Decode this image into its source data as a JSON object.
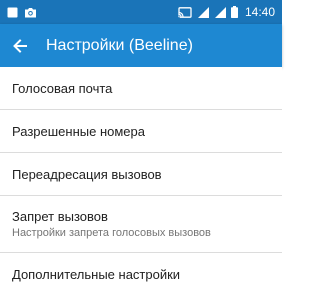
{
  "status_bar": {
    "time": "14:40",
    "left_icons": [
      "notification-square-icon",
      "camera-icon"
    ],
    "right_icons": [
      "cast-icon",
      "wifi-signal-icon",
      "cell-signal-icon",
      "battery-icon"
    ]
  },
  "toolbar": {
    "title": "Настройки (Beeline)",
    "back_icon": "arrow-left-icon"
  },
  "menu": {
    "items": [
      {
        "title": "Голосовая почта"
      },
      {
        "title": "Разрешенные номера"
      },
      {
        "title": "Переадресация вызовов"
      },
      {
        "title": "Запрет вызовов",
        "subtitle": "Настройки запрета голосовых вызовов"
      },
      {
        "title": "Дополнительные настройки"
      }
    ]
  },
  "colors": {
    "status_bar": "#1a74b8",
    "toolbar": "#1e88d2",
    "divider": "#dcdcdc"
  }
}
